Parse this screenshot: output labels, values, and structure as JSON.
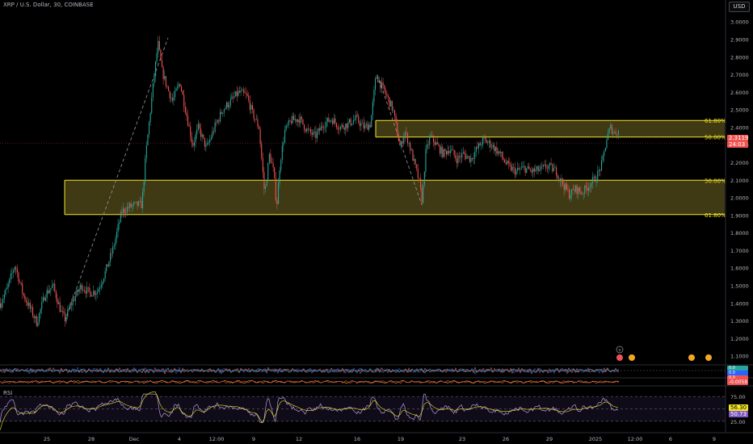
{
  "header": {
    "symbol_title": "XRP / U.S. Dollar, 30, COINBASE",
    "currency": "USD"
  },
  "colors": {
    "bg": "#000000",
    "up": "#26a69a",
    "down": "#ef5350",
    "fib": "#f5e52a",
    "fib_fill": "#4a4416",
    "rsi": "#b39ddb"
  },
  "price_labels": {
    "current_price": "2.3119",
    "countdown": "24:03"
  },
  "indicator_labels": {
    "osc1_values": [
      "0.0",
      "0.0",
      "0.0"
    ],
    "osc2_value": "-0.0058",
    "rsi_title": "RSI",
    "rsi_value": "56.30",
    "rsi_value2": "50.73"
  },
  "chart_data": {
    "type": "candlestick",
    "title": "XRP / U.S. Dollar, 30, COINBASE",
    "y_axis": {
      "ticks": [
        "3.0000",
        "2.9000",
        "2.8000",
        "2.7000",
        "2.6000",
        "2.5000",
        "2.4000",
        "2.3000",
        "2.2000",
        "2.1000",
        "2.0000",
        "1.9000",
        "1.8000",
        "1.7000",
        "1.6000",
        "1.5000",
        "1.4000",
        "1.3000",
        "1.2000",
        "1.1000"
      ],
      "ylim": [
        1.05,
        3.07
      ]
    },
    "x_axis": {
      "ticks": [
        "25",
        "28",
        "Dec",
        "4",
        "12:00",
        "9",
        "12",
        "16",
        "19",
        "23",
        "26",
        "29",
        "2025",
        "12:00",
        "6",
        "9"
      ]
    },
    "close_path": [
      {
        "x": 0,
        "y": 1.4
      },
      {
        "x": 8,
        "y": 1.48
      },
      {
        "x": 18,
        "y": 1.62
      },
      {
        "x": 28,
        "y": 1.45
      },
      {
        "x": 38,
        "y": 1.36
      },
      {
        "x": 45,
        "y": 1.29
      },
      {
        "x": 55,
        "y": 1.45
      },
      {
        "x": 65,
        "y": 1.5
      },
      {
        "x": 75,
        "y": 1.35
      },
      {
        "x": 80,
        "y": 1.31
      },
      {
        "x": 90,
        "y": 1.42
      },
      {
        "x": 100,
        "y": 1.5
      },
      {
        "x": 110,
        "y": 1.46
      },
      {
        "x": 120,
        "y": 1.47
      },
      {
        "x": 130,
        "y": 1.58
      },
      {
        "x": 140,
        "y": 1.72
      },
      {
        "x": 150,
        "y": 1.92
      },
      {
        "x": 160,
        "y": 1.95
      },
      {
        "x": 170,
        "y": 1.96
      },
      {
        "x": 175,
        "y": 1.96
      },
      {
        "x": 180,
        "y": 2.25
      },
      {
        "x": 188,
        "y": 2.6
      },
      {
        "x": 195,
        "y": 2.88
      },
      {
        "x": 200,
        "y": 2.72
      },
      {
        "x": 207,
        "y": 2.62
      },
      {
        "x": 213,
        "y": 2.55
      },
      {
        "x": 222,
        "y": 2.66
      },
      {
        "x": 230,
        "y": 2.48
      },
      {
        "x": 238,
        "y": 2.3
      },
      {
        "x": 245,
        "y": 2.4
      },
      {
        "x": 255,
        "y": 2.28
      },
      {
        "x": 265,
        "y": 2.4
      },
      {
        "x": 275,
        "y": 2.5
      },
      {
        "x": 285,
        "y": 2.55
      },
      {
        "x": 295,
        "y": 2.6
      },
      {
        "x": 305,
        "y": 2.58
      },
      {
        "x": 312,
        "y": 2.48
      },
      {
        "x": 320,
        "y": 2.4
      },
      {
        "x": 327,
        "y": 2.02
      },
      {
        "x": 333,
        "y": 2.25
      },
      {
        "x": 338,
        "y": 2.15
      },
      {
        "x": 342,
        "y": 1.95
      },
      {
        "x": 346,
        "y": 2.2
      },
      {
        "x": 352,
        "y": 2.38
      },
      {
        "x": 360,
        "y": 2.44
      },
      {
        "x": 370,
        "y": 2.45
      },
      {
        "x": 380,
        "y": 2.38
      },
      {
        "x": 390,
        "y": 2.35
      },
      {
        "x": 400,
        "y": 2.42
      },
      {
        "x": 410,
        "y": 2.45
      },
      {
        "x": 420,
        "y": 2.4
      },
      {
        "x": 430,
        "y": 2.42
      },
      {
        "x": 440,
        "y": 2.45
      },
      {
        "x": 450,
        "y": 2.4
      },
      {
        "x": 458,
        "y": 2.42
      },
      {
        "x": 465,
        "y": 2.7
      },
      {
        "x": 470,
        "y": 2.65
      },
      {
        "x": 478,
        "y": 2.58
      },
      {
        "x": 486,
        "y": 2.5
      },
      {
        "x": 490,
        "y": 2.4
      },
      {
        "x": 495,
        "y": 2.28
      },
      {
        "x": 500,
        "y": 2.38
      },
      {
        "x": 505,
        "y": 2.32
      },
      {
        "x": 512,
        "y": 2.2
      },
      {
        "x": 518,
        "y": 2.1
      },
      {
        "x": 522,
        "y": 1.98
      },
      {
        "x": 526,
        "y": 2.25
      },
      {
        "x": 532,
        "y": 2.35
      },
      {
        "x": 540,
        "y": 2.3
      },
      {
        "x": 548,
        "y": 2.25
      },
      {
        "x": 556,
        "y": 2.28
      },
      {
        "x": 565,
        "y": 2.22
      },
      {
        "x": 573,
        "y": 2.25
      },
      {
        "x": 582,
        "y": 2.22
      },
      {
        "x": 590,
        "y": 2.28
      },
      {
        "x": 598,
        "y": 2.33
      },
      {
        "x": 608,
        "y": 2.3
      },
      {
        "x": 618,
        "y": 2.25
      },
      {
        "x": 628,
        "y": 2.18
      },
      {
        "x": 638,
        "y": 2.15
      },
      {
        "x": 648,
        "y": 2.17
      },
      {
        "x": 658,
        "y": 2.15
      },
      {
        "x": 668,
        "y": 2.16
      },
      {
        "x": 678,
        "y": 2.18
      },
      {
        "x": 688,
        "y": 2.15
      },
      {
        "x": 696,
        "y": 2.08
      },
      {
        "x": 704,
        "y": 2.02
      },
      {
        "x": 712,
        "y": 2.05
      },
      {
        "x": 720,
        "y": 2.03
      },
      {
        "x": 730,
        "y": 2.08
      },
      {
        "x": 738,
        "y": 2.12
      },
      {
        "x": 745,
        "y": 2.2
      },
      {
        "x": 750,
        "y": 2.33
      },
      {
        "x": 755,
        "y": 2.4
      },
      {
        "x": 760,
        "y": 2.37
      },
      {
        "x": 766,
        "y": 2.38
      }
    ],
    "dashed_trend_lines": [
      {
        "from": {
          "x": 80,
          "y": 1.3
        },
        "to": {
          "x": 208,
          "y": 2.91
        }
      },
      {
        "from": {
          "x": 467,
          "y": 2.7
        },
        "to": {
          "x": 522,
          "y": 1.96
        }
      }
    ],
    "fib_zones": [
      {
        "x_start": 80,
        "top": 2.1,
        "bottom": 1.905,
        "top_label": "50.00%",
        "bottom_label": "61.80%"
      },
      {
        "x_start": 465,
        "top": 2.44,
        "bottom": 2.346,
        "top_label": "61.80%",
        "bottom_label": "50.00%"
      }
    ],
    "current_price": 2.3119,
    "rsi": {
      "title": "RSI",
      "levels": [
        75,
        50,
        25
      ],
      "level_labels": [
        "75.00",
        "50.00",
        "25.00"
      ],
      "last": 56.3,
      "ylim": [
        15,
        85
      ]
    },
    "grid": false,
    "legend": "none"
  }
}
